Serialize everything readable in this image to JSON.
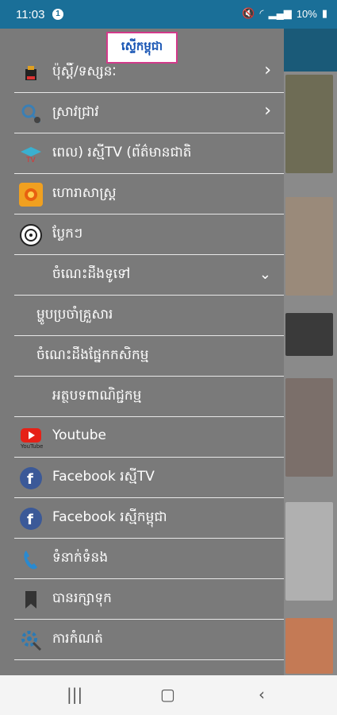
{
  "status": {
    "time": "11:03",
    "notif_count": "1",
    "battery": "10%"
  },
  "logo_text": "ស្ទើកម្ពុជា",
  "menu": {
    "item0": "ប៉ុស្តិ៍/ទស្សនៈ",
    "item1": "ស្រាវជ្រាវ",
    "item2": "ពេល)            រស្មីTV (ព័ត៌មានជាតិ",
    "item3": "ហោរាសាស្ត្រ",
    "item4": "ប្លែកៗ",
    "item5": "ចំណេះដឹងទូទៅ",
    "sub1": "ម្ហូបប្រចាំគ្រួសារ",
    "sub2": "ចំណេះដឹងផ្នែកកសិកម្ម",
    "sub3": "អត្ថបទពាណិជ្ជកម្ម",
    "youtube": "Youtube",
    "fb1": "Facebook រស្មីTV",
    "fb2": "Facebook រស្មីកម្ពុជា",
    "contact": "ទំនាក់ទំនង",
    "saved": "បានរក្សាទុក",
    "settings": "ការកំណត់"
  },
  "icons": {
    "news": "news-icon",
    "research": "research-icon",
    "tv": "tv-icon",
    "astro": "astrology-icon",
    "weird": "weird-icon",
    "youtube": "youtube-icon",
    "facebook": "facebook-icon",
    "phone": "phone-icon",
    "bookmark": "bookmark-icon",
    "settings": "settings-icon"
  },
  "colors": {
    "status_bar": "#1a6f98",
    "drawer": "#7a7a7a",
    "facebook": "#3b5998",
    "youtube": "#e62117"
  }
}
